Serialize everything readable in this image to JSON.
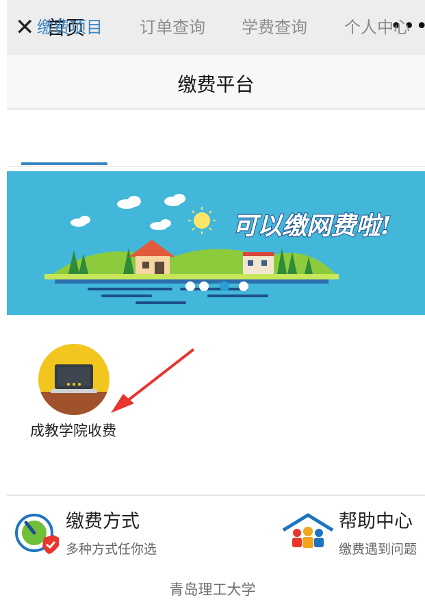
{
  "topbar": {
    "title": "首页",
    "close_glyph": "✕",
    "more_glyph": "•••"
  },
  "header": {
    "title": "缴费平台"
  },
  "tabs": [
    "缴费项目",
    "订单查询",
    "学费查询",
    "个人中心"
  ],
  "banner": {
    "slogan": "可以缴网费啦!"
  },
  "items": [
    {
      "label": "成教学院收费"
    }
  ],
  "footer": {
    "payment": {
      "title": "缴费方式",
      "subtitle": "多种方式任你选"
    },
    "help": {
      "title": "帮助中心",
      "subtitle": "缴费遇到问题"
    },
    "school": "青岛理工大学"
  },
  "colors": {
    "accent": "#3a86c4",
    "banner_bg": "#43b7d9",
    "icon_bg": "#f2c61f"
  }
}
